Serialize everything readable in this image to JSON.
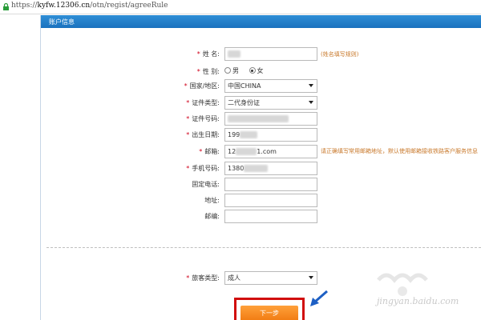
{
  "browser": {
    "url_scheme": "https://",
    "url_host": "kyfw.12306.cn",
    "url_path": "/otn/regist/agreeRule"
  },
  "panel": {
    "title": "账户信息"
  },
  "form": {
    "name": {
      "label": "姓 名:",
      "required": "*",
      "value": "",
      "hint": "(姓名填写规则)"
    },
    "gender": {
      "label": "性 别:",
      "required": "*",
      "options": [
        "男",
        "女"
      ],
      "selected": "女"
    },
    "country": {
      "label": "国家/地区:",
      "required": "*",
      "value": "中国CHINA"
    },
    "id_type": {
      "label": "证件类型:",
      "required": "*",
      "value": "二代身份证"
    },
    "id_number": {
      "label": "证件号码:",
      "required": "*",
      "value": ""
    },
    "birth_date": {
      "label": "出生日期:",
      "required": "*",
      "value": "199"
    },
    "email": {
      "label": "邮箱:",
      "required": "*",
      "value_prefix": "12",
      "value_suffix": "1.com",
      "hint": "请正确填写常用邮箱地址，默认使用邮箱接收铁路客户服务信息"
    },
    "mobile": {
      "label": "手机号码:",
      "required": "*",
      "value": "1380"
    },
    "phone": {
      "label": "固定电话:",
      "value": ""
    },
    "address": {
      "label": "地址:",
      "value": ""
    },
    "postcode": {
      "label": "邮编:",
      "value": ""
    },
    "passenger_type": {
      "label": "旅客类型:",
      "required": "*",
      "value": "成人"
    }
  },
  "actions": {
    "next_label": "下一步"
  },
  "watermark": {
    "text": "jingyan.baidu.com"
  },
  "colors": {
    "header": "#1f7fca",
    "highlight": "#d10c0c",
    "button": "#f58a1f",
    "hint": "#c8782a"
  }
}
